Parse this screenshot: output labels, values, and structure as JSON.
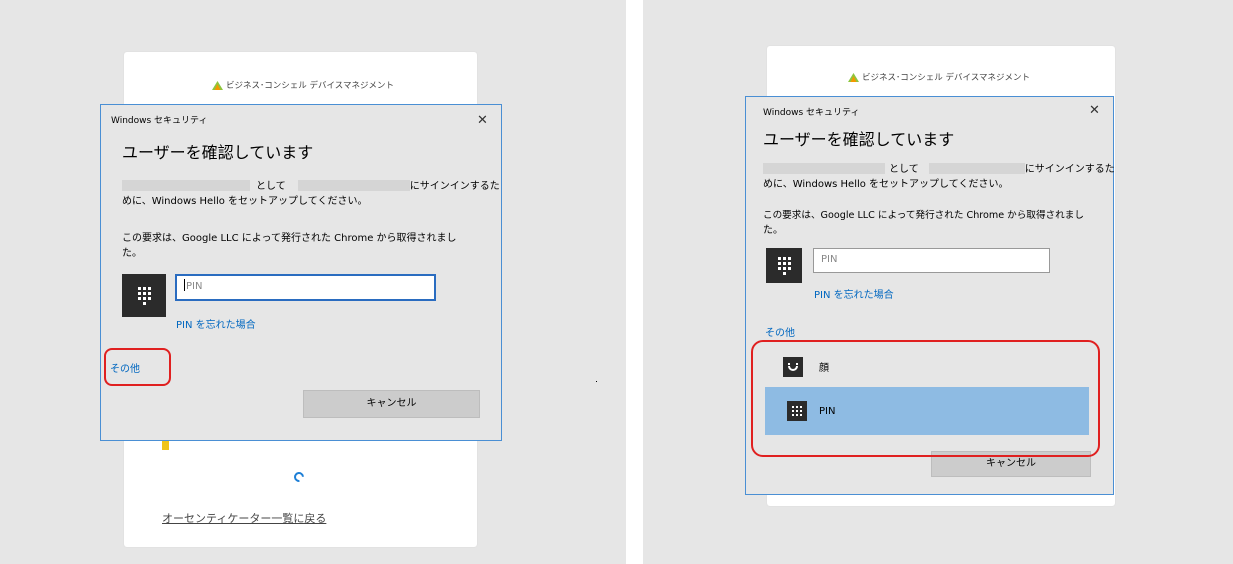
{
  "brand": {
    "name": "ビジネス･コンシェル デバイスマネジメント"
  },
  "dialog": {
    "window_title": "Windows セキュリティ",
    "close_glyph": "✕",
    "heading": "ユーザーを確認しています",
    "signin_text_as": "として",
    "signin_text_line1_tail": "にサインインするた",
    "signin_text_line2": "めに、Windows Hello をセットアップしてください。",
    "request_text_line1": "この要求は、Google LLC によって発行された Chrome から取得されまし",
    "request_text_line2": "た。",
    "pin_placeholder": "PIN",
    "forgot_pin_link": "PIN を忘れた場合",
    "more_options_link": "その他",
    "cancel_button": "キャンセル"
  },
  "options": [
    {
      "label": "顔",
      "icon": "face-icon",
      "selected": false
    },
    {
      "label": "PIN",
      "icon": "keypad-icon",
      "selected": true
    }
  ],
  "page": {
    "back_link": "オーセンティケーター一覧に戻る"
  },
  "colors": {
    "dialog_border": "#4a8fd4",
    "link": "#0067c0",
    "highlight": "#e02020",
    "selected": "#8ebbe3"
  }
}
